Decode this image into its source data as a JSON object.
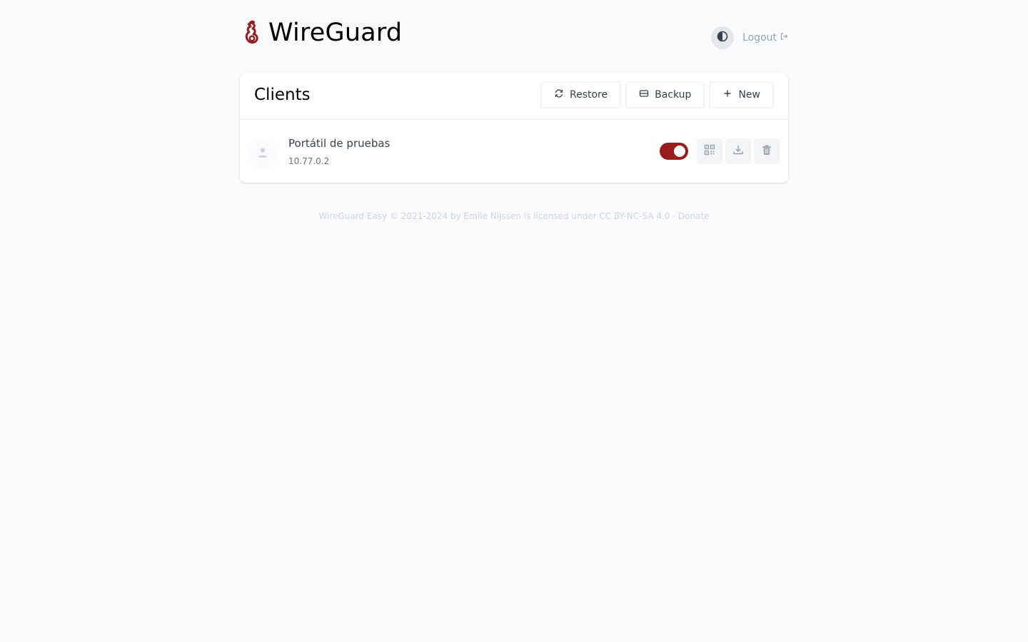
{
  "header": {
    "title": "WireGuard",
    "logout_label": "Logout"
  },
  "clients_card": {
    "title": "Clients",
    "buttons": {
      "restore": "Restore",
      "backup": "Backup",
      "new": "New"
    },
    "clients": [
      {
        "name": "Portátil de pruebas",
        "address": "10.77.0.2",
        "enabled": true
      }
    ]
  },
  "footer": {
    "product": "WireGuard Easy",
    "copyright": "© 2021-2024 by",
    "author": "Emile Nijssen",
    "license_prefix": "is licensed under",
    "license": "CC BY-NC-SA 4.0",
    "separator": "·",
    "donate": "Donate"
  },
  "colors": {
    "accent": "#991b1b",
    "background": "#f9fafc"
  },
  "icons": {
    "brand": "wireguard-logo-icon",
    "theme": "contrast-icon",
    "logout": "logout-icon",
    "restore": "refresh-icon",
    "backup": "database-icon",
    "new": "plus-icon",
    "avatar": "user-icon",
    "qr": "qr-code-icon",
    "download": "download-icon",
    "delete": "trash-icon"
  }
}
